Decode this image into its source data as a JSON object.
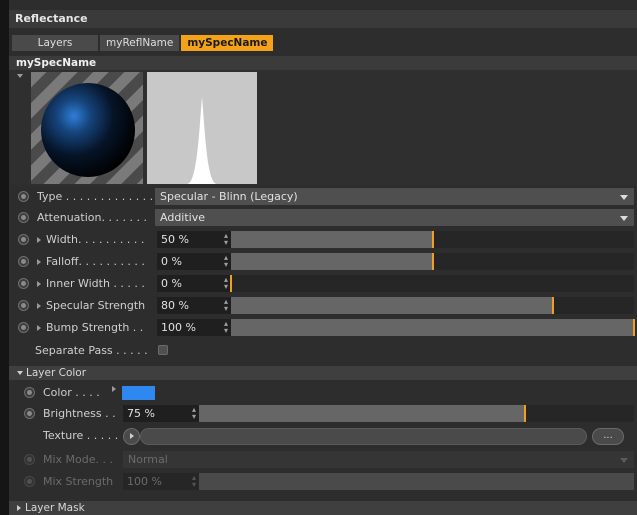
{
  "panel": {
    "title": "Reflectance"
  },
  "tabs": [
    {
      "label": "Layers",
      "active": false
    },
    {
      "label": "myReflName",
      "active": false
    },
    {
      "label": "mySpecName",
      "active": true
    }
  ],
  "section": {
    "title": "mySpecName"
  },
  "preview": {
    "sphere_icon": "material-sphere-preview",
    "histogram_icon": "specular-falloff-curve"
  },
  "params": {
    "type": {
      "label": "Type . . . . . . . . . . . . .",
      "value": "Specular - Blinn (Legacy)"
    },
    "attenuation": {
      "label": "Attenuation. . . . . . .",
      "value": "Additive"
    },
    "width": {
      "label": "Width. . . . . . . . . .",
      "value": "50 %",
      "level": 0.5
    },
    "falloff": {
      "label": "Falloff. . . . . . . . . .",
      "value": "0 %",
      "level": 0.5
    },
    "inner_width": {
      "label": "Inner Width . . . . .",
      "value": "0 %",
      "level": 0.0
    },
    "specular_strength": {
      "label": "Specular Strength",
      "value": "80 %",
      "level": 0.8
    },
    "bump_strength": {
      "label": "Bump Strength . .",
      "value": "100 %",
      "level": 1.0
    },
    "separate_pass": {
      "label": "Separate Pass . . . . .",
      "checked": false
    }
  },
  "layer_color": {
    "title": "Layer Color",
    "color": {
      "label": "Color . . . .",
      "value": "#2f87f0"
    },
    "brightness": {
      "label": "Brightness . .",
      "value": "75 %",
      "level": 0.75
    },
    "texture": {
      "label": "Texture . . . . .",
      "button": "..."
    },
    "mix_mode": {
      "label": "Mix Mode. . .",
      "value": "Normal"
    },
    "mix_strength": {
      "label": "Mix Strength",
      "value": "100 %",
      "level": 1.0
    }
  },
  "layer_mask": {
    "title": "Layer Mask"
  },
  "colors": {
    "accent": "#f3a21a",
    "swatch": "#2f87f0",
    "bg": "#2d2d2d"
  }
}
